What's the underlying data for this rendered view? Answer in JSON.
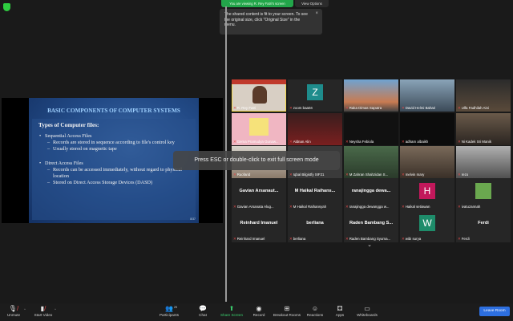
{
  "banner": {
    "viewing": "You are viewing R. Rey Fatri's screen",
    "view_options": "View Options"
  },
  "tooltip": {
    "text": "The shared content is fit to your screen. To see the original size, click \"Original Size\" in the menu.",
    "close": "×"
  },
  "slide": {
    "title": "BASIC COMPONENTS OF COMPUTER SYSTEMS",
    "heading": "Types of Computer files:",
    "seq": "Sequential Access Files",
    "seq1": "Records are stored in sequence according to file's control key",
    "seq2": "Usually stored on magnetic tape",
    "dir": "Direct Access Files",
    "dir1": "Records can be accessed immediately, without regard to physical location",
    "dir2": "Stored on Direct Access Storage Devices (DASD)",
    "page": "8/37"
  },
  "gallery": {
    "t1": "R. Rey Fatri",
    "t2": "zoom baa04",
    "t3": "Raka Dimas Saputra",
    "t4": "David Helmi Bahari",
    "t5": "Ulfa Fadhilah Aini",
    "t6": "Gema Pramudya Gunaw...",
    "t7": "Aldnan Alin",
    "t8": "Neysha Febiola",
    "t9": "adham albaikh",
    "t10": "Ni Kadek Sri Manik",
    "t11": "Ruofarid",
    "t12": "Iqbal Bilgistfy SIF21",
    "t13": "M Zahran Shahzidan S...",
    "t14": "melvin mary",
    "t15": "rezo",
    "t16_big": "Gavian Arsanaut...",
    "t16": "Gavian Arsanata Alug...",
    "t17_big": "M Haikal Raihans...",
    "t17": "M Haikal Raihansyah",
    "t18_big": "ranajingga dewa...",
    "t18": "ranajingga dewangga w...",
    "t19": "Haikal setiawan",
    "t20": "ivatuzannah",
    "t21_big": "Reinhard Imanuel",
    "t21": "Reinhard Imanuel",
    "t22_big": "berliana",
    "t22": "berliana",
    "t23_big": "Raden Bambang S...",
    "t23": "Raden Bambang Syuma...",
    "t24": "wibi surya",
    "t25_big": "Ferdi",
    "t25": "Ferdi",
    "avatar_z": "Z",
    "avatar_h": "H",
    "avatar_w": "W"
  },
  "esc_message": "Press ESC or double-click to exit full screen mode",
  "toolbar": {
    "unmute": "Unmute",
    "start_video": "Start Video",
    "participants": "Participants",
    "participants_count": "29",
    "chat": "Chat",
    "share_screen": "Share Screen",
    "record": "Record",
    "breakout": "Breakout Rooms",
    "reactions": "Reactions",
    "apps": "Apps",
    "whiteboards": "Whiteboards",
    "leave": "Leave Room"
  },
  "colors": {
    "accent_green": "#22a64a",
    "leave_blue": "#2d6fe0",
    "mic_red": "#e14b4b",
    "active_yellow": "#f2d64b"
  },
  "icons": [
    "shield-icon",
    "close-icon",
    "mic-off-icon",
    "video-off-icon",
    "participants-icon",
    "chat-icon",
    "share-screen-icon",
    "record-icon",
    "breakout-icon",
    "reactions-icon",
    "apps-icon",
    "whiteboards-icon",
    "chevron-down-icon"
  ]
}
